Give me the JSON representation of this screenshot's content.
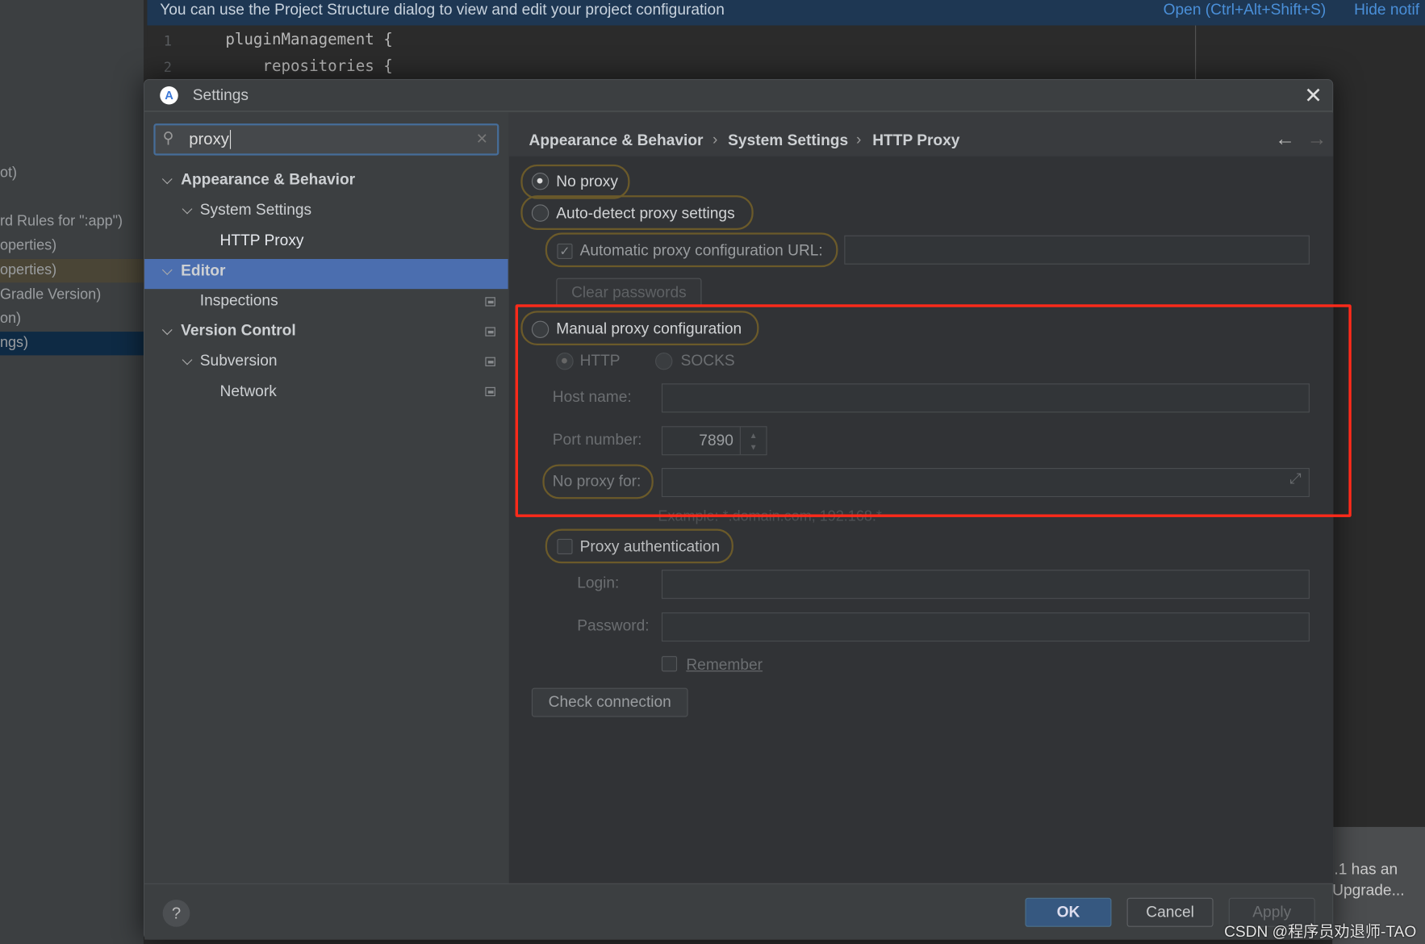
{
  "background": {
    "left_items": [
      "ot)",
      "rd Rules for \":app\")",
      "operties)",
      "operties)",
      "Gradle Version)",
      "on)",
      "ngs)"
    ],
    "banner_text": "You can use the Project Structure dialog to view and edit your project configuration",
    "banner_links": [
      "Open (Ctrl+Alt+Shift+S)",
      "Hide notif"
    ],
    "editor_lines": [
      {
        "n": "1",
        "code": "pluginManagement {"
      },
      {
        "n": "2",
        "code": "    repositories {"
      }
    ],
    "notification": [
      ".1 has an",
      "Upgrade..."
    ],
    "watermark": "CSDN @程序员劝退师-TAO"
  },
  "dialog": {
    "title": "Settings",
    "search": {
      "value": "proxy",
      "placeholder": ""
    },
    "tree": [
      {
        "label": "Appearance & Behavior",
        "bold": true
      },
      {
        "label": "System Settings"
      },
      {
        "label": "HTTP Proxy",
        "selected": true
      },
      {
        "label": "Editor",
        "bold": true
      },
      {
        "label": "Inspections"
      },
      {
        "label": "Version Control",
        "bold": true
      },
      {
        "label": "Subversion"
      },
      {
        "label": "Network"
      }
    ],
    "breadcrumb": [
      "Appearance & Behavior",
      "System Settings",
      "HTTP Proxy"
    ],
    "proxy": {
      "no_proxy": "No proxy",
      "auto_detect": "Auto-detect proxy settings",
      "auto_url_label": "Automatic proxy configuration URL:",
      "auto_url_value": "",
      "clear_passwords": "Clear passwords",
      "manual": "Manual proxy configuration",
      "http": "HTTP",
      "socks": "SOCKS",
      "host_label": "Host name:",
      "host_value": "",
      "port_label": "Port number:",
      "port_value": "7890",
      "no_proxy_for_label": "No proxy for:",
      "no_proxy_for_value": "",
      "example": "Example: *.domain.com, 192.168.*",
      "proxy_auth": "Proxy authentication",
      "login_label": "Login:",
      "password_label": "Password:",
      "remember": "Remember",
      "check_connection": "Check connection",
      "selected_mode": "No proxy"
    },
    "footer": {
      "help": "?",
      "ok": "OK",
      "cancel": "Cancel",
      "apply": "Apply"
    }
  },
  "colors": {
    "accent": "#4b6eaf",
    "highlight": "#ff2a1a",
    "link": "#4a8fd8"
  }
}
